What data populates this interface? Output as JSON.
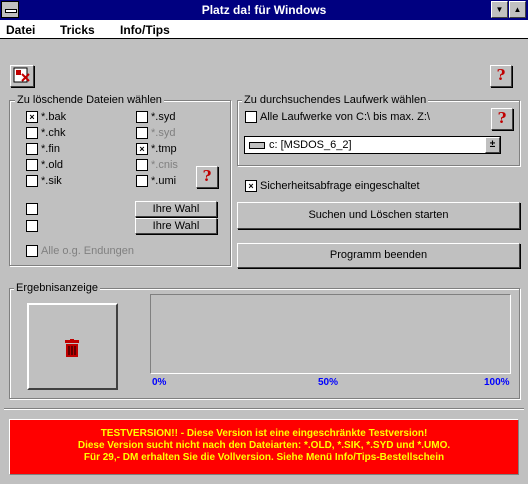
{
  "window": {
    "title": "Platz da! für Windows",
    "minimize_glyph": "▼",
    "maximize_glyph": "▲"
  },
  "menu": {
    "items": [
      "Datei",
      "Tricks",
      "Info/Tips"
    ]
  },
  "toolbar": {
    "app_icon": "disk-file-icon",
    "help_glyph": "?"
  },
  "files_group": {
    "label": "Zu löschende Dateien wählen",
    "col1": [
      {
        "label": "*.bak",
        "checked": true
      },
      {
        "label": "*.chk",
        "checked": false
      },
      {
        "label": "*.fin",
        "checked": false
      },
      {
        "label": "*.old",
        "checked": false
      },
      {
        "label": "*.sik",
        "checked": false
      }
    ],
    "col2": [
      {
        "label": "*.syd",
        "checked": false
      },
      {
        "label": "*.syd",
        "checked": false,
        "disabled": true
      },
      {
        "label": "*.tmp",
        "checked": true
      },
      {
        "label": "*.cnis",
        "checked": false,
        "disabled": true
      },
      {
        "label": "*.umi",
        "checked": false
      }
    ],
    "custom1_button": "Ihre Wahl",
    "custom2_button": "Ihre Wahl",
    "all_ext_label": "Alle o.g. Endungen",
    "help_glyph": "?"
  },
  "drive_group": {
    "label": "Zu durchsuchendes Laufwerk wählen",
    "all_drives_label": "Alle Laufwerke von C:\\ bis max. Z:\\",
    "drive_value": "c: [MSDOS_6_2]",
    "dropdown_glyph": "±",
    "help_glyph": "?"
  },
  "safety": {
    "label": "Sicherheitsabfrage eingeschaltet",
    "checked": true
  },
  "buttons": {
    "search_delete": "Suchen und Löschen starten",
    "quit": "Programm beenden"
  },
  "results": {
    "label": "Ergebnisanzeige",
    "trash_icon": "trash-can-icon",
    "progress_value": 0,
    "scale_left": "0%",
    "scale_mid": "50%",
    "scale_right": "100%"
  },
  "test_notice": {
    "line1": "TESTVERSION!! - Diese Version ist eine eingeschränkte Testversion!",
    "line2": "Diese Version sucht nicht nach den Dateiarten: *.OLD, *.SIK, *.SYD und *.UMO.",
    "line3": "Für 29,- DM erhalten Sie die Vollversion. Siehe Menü Info/Tips-Bestellschein"
  },
  "colors": {
    "title_bar": "#000080",
    "window_bg": "#c0c0c0",
    "notice_bg": "#ff0000",
    "notice_text": "#ffff00",
    "help_glyph": "#c00000",
    "progress_labels": "#0000ff"
  }
}
